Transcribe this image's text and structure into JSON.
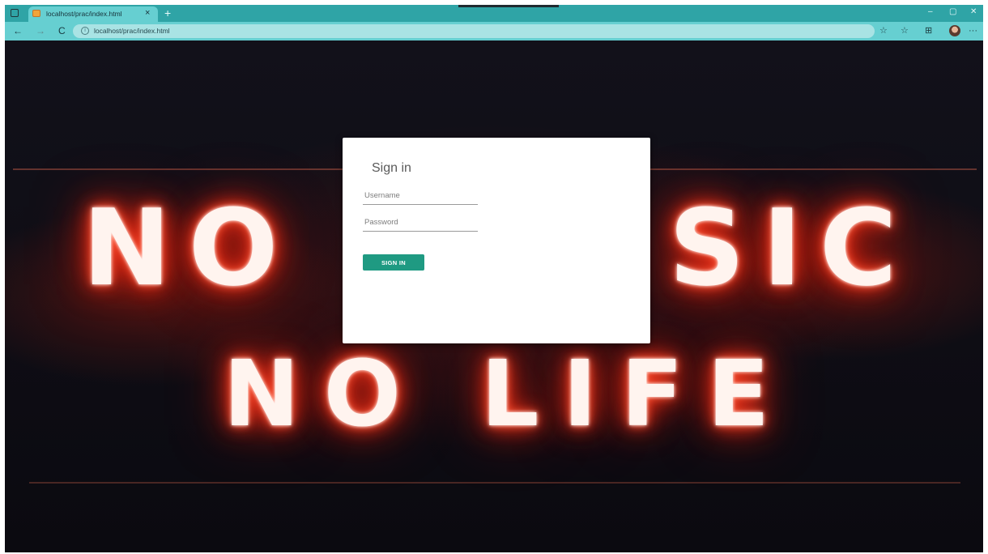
{
  "browser": {
    "tab_title": "localhost/prac/index.html",
    "tab_close": "×",
    "new_tab": "+",
    "minimize": "–",
    "restore": "▢",
    "close": "✕",
    "back": "←",
    "forward": "→",
    "reload": "C",
    "url": "localhost/prac/index.html",
    "info_glyph": "i",
    "more": "···",
    "colors": {
      "titlebar": "#2fa4a6",
      "toolbar": "#66cfd1",
      "address": "#a9e3e4"
    }
  },
  "background": {
    "neon_line1": "NO",
    "neon_line1b": "SIC",
    "neon_line2": "NO LIFE"
  },
  "signin": {
    "title": "Sign in",
    "username_placeholder": "Username",
    "password_placeholder": "Password",
    "button_label": "SIGN IN",
    "button_color": "#1f9a82"
  }
}
